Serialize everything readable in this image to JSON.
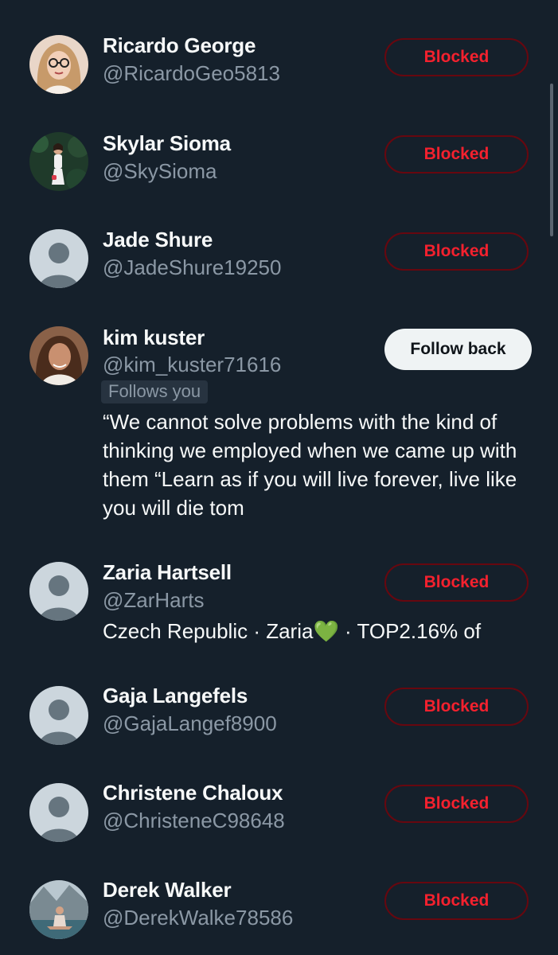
{
  "users": [
    {
      "name": "Ricardo George",
      "handle": "@RicardoGeo5813",
      "button": "Blocked"
    },
    {
      "name": "Skylar Sioma",
      "handle": "@SkySioma",
      "button": "Blocked"
    },
    {
      "name": "Jade Shure",
      "handle": "@JadeShure19250",
      "button": "Blocked"
    },
    {
      "name": "kim kuster",
      "handle": "@kim_kuster71616",
      "badge": "Follows you",
      "button": "Follow back",
      "bio": "“We cannot solve problems with the kind of thinking we employed when we came up with them “Learn as if you will live forever, live like you will die tom"
    },
    {
      "name": "Zaria Hartsell",
      "handle": "@ZarHarts",
      "button": "Blocked",
      "bio_part1": "Czech Republic · Zaria",
      "bio_emoji": "💚",
      "bio_part2": " · TOP2.16% of"
    },
    {
      "name": "Gaja Langefels",
      "handle": "@GajaLangef8900",
      "button": "Blocked"
    },
    {
      "name": "Christene Chaloux",
      "handle": "@ChristeneC98648",
      "button": "Blocked"
    },
    {
      "name": "Derek Walker",
      "handle": "@DerekWalke78586",
      "button": "Blocked"
    }
  ],
  "colors": {
    "background": "#15202b",
    "blocked_text": "#f4212e",
    "blocked_border": "#67070f",
    "follow_back_bg": "#eff3f4",
    "secondary_text": "#8b98a5"
  },
  "icons": {
    "default_avatar": "default-avatar-icon"
  }
}
